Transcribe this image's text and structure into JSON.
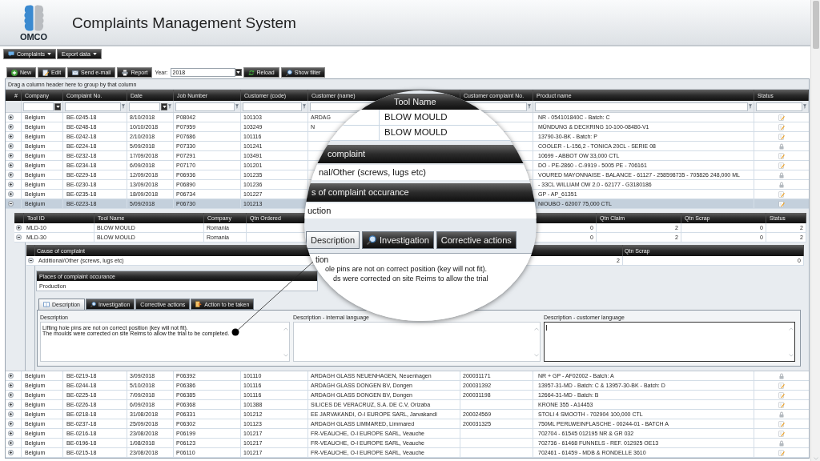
{
  "header": {
    "logo_text": "OMCO",
    "title": "Complaints Management System"
  },
  "menu": [
    {
      "label": "Complaints"
    },
    {
      "label": "Export data"
    }
  ],
  "toolbar": {
    "buttons": [
      "New",
      "Edit",
      "Send e-mail",
      "Report"
    ],
    "year": {
      "label": "Year:",
      "value": "2018"
    },
    "buttons_right": [
      "Reload",
      "Show filter"
    ]
  },
  "grid": {
    "group_hint": "Drag a column header here to group by that column",
    "columns": [
      "#",
      "Company",
      "Complaint No.",
      "Date",
      "Job Number",
      "Customer (code)",
      "Customer (name)",
      "Customer complaint No.",
      "Product name",
      "Status"
    ],
    "rows_top": [
      {
        "company": "Belgium",
        "complaint_no": "BE-0245-18",
        "date": "8/10/2018",
        "job_number": "P08042",
        "customer_code": "101103",
        "customer_name": "ARDAG",
        "product_name": "NR - 054101840C - Batch: C",
        "locked": false,
        "expanded": false,
        "selected": false
      },
      {
        "company": "Belgium",
        "complaint_no": "BE-0248-18",
        "date": "10/10/2018",
        "job_number": "P07959",
        "customer_code": "103249",
        "customer_name": "N",
        "product_name": "MÜNDUNG & DECKRING 10-100-08480-V1",
        "locked": false,
        "expanded": false,
        "selected": false
      },
      {
        "company": "Belgium",
        "complaint_no": "BE-0242-18",
        "date": "2/10/2018",
        "job_number": "P07686",
        "customer_code": "101116",
        "product_name": "13790-30-BK - Batch: P",
        "locked": false,
        "expanded": false,
        "selected": false
      },
      {
        "company": "Belgium",
        "complaint_no": "BE-0224-18",
        "date": "5/09/2018",
        "job_number": "P07330",
        "customer_code": "101241",
        "product_name": "COOLER - L-156,2 - TONICA 20CL - SERIE 08",
        "locked": true,
        "expanded": false,
        "selected": false
      },
      {
        "company": "Belgium",
        "complaint_no": "BE-0232-18",
        "date": "17/09/2018",
        "job_number": "P07291",
        "customer_code": "103491",
        "product_name": "10699 - ABBOT OW 33,000 CTL",
        "locked": false,
        "expanded": false,
        "selected": false
      },
      {
        "company": "Belgium",
        "complaint_no": "BE-0234-18",
        "date": "6/09/2018",
        "job_number": "P07170",
        "customer_code": "101201",
        "product_name": "DO - PE-2860 - C-9919 - 5005 PE - 706161",
        "locked": false,
        "expanded": false,
        "selected": false
      },
      {
        "company": "Belgium",
        "complaint_no": "BE-0229-18",
        "date": "12/09/2018",
        "job_number": "P06936",
        "customer_code": "101235",
        "product_name": "VOURED MAYONNAISE - BALANCE - 61127 - 258598735 - 705826 248,000 ML",
        "locked": true,
        "expanded": false,
        "selected": false
      },
      {
        "company": "Belgium",
        "complaint_no": "BE-0230-18",
        "date": "13/09/2018",
        "job_number": "P06890",
        "customer_code": "101236",
        "product_name": "- 33CL WILLIAM OW 2.0 - 62177 - G3180186",
        "locked": true,
        "expanded": false,
        "selected": false
      },
      {
        "company": "Belgium",
        "complaint_no": "BE-0235-18",
        "date": "18/09/2018",
        "job_number": "P06734",
        "customer_code": "101227",
        "product_name": "GP - AP_61351",
        "locked": false,
        "expanded": false,
        "selected": false
      },
      {
        "company": "Belgium",
        "complaint_no": "BE-0223-18",
        "date": "5/09/2018",
        "job_number": "P06730",
        "customer_code": "101213",
        "product_name": "NIOUBO - 62007 75,000 CTL",
        "locked": false,
        "expanded": true,
        "selected": true
      }
    ],
    "detail": {
      "tools": {
        "columns": [
          "Tool ID",
          "Tool Name",
          "Company",
          "Qtn Ordered",
          "Qtn Claim",
          "Qtn Scrap",
          "Status"
        ],
        "rows": [
          {
            "tool_id": "MLD-10",
            "tool_name": "BLOW MOULD",
            "company": "Romania",
            "column_5": "0",
            "qtn_claim": "2",
            "qtn_scrap": "0",
            "status": "2",
            "expanded": false
          },
          {
            "tool_id": "MLD-30",
            "tool_name": "BLOW MOULD",
            "company": "Romania",
            "column_5": "0",
            "qtn_claim": "2",
            "qtn_scrap": "0",
            "status": "2",
            "expanded": true
          }
        ]
      },
      "causes": {
        "columns": [
          "Cause of complaint",
          "Qtn Scrap"
        ],
        "rows": [
          {
            "cause": "Additional/Other (screws, lugs etc)",
            "column_3": "2",
            "qtn_scrap": "0",
            "expanded": true
          }
        ]
      },
      "places": {
        "column": "Places of complaint occurance",
        "rows": [
          "Production"
        ]
      },
      "tabs": [
        {
          "label": "Description",
          "selected": true
        },
        {
          "label": "Investigation",
          "selected": false
        },
        {
          "label": "Corrective actions",
          "selected": false
        },
        {
          "label": "Action to be taken",
          "selected": false
        }
      ],
      "fields": [
        {
          "label": "Description",
          "lines": [
            "Lifting hole pins are not on correct position (key will not fit).",
            "The moulds were corrected on site Reims to allow the trial to be completed."
          ],
          "focused": false
        },
        {
          "label": "Description - internal language",
          "focused": false
        },
        {
          "label": "Description - customer language",
          "focused": true
        }
      ]
    },
    "rows_bottom": [
      {
        "company": "Belgium",
        "complaint_no": "BE-0219-18",
        "date": "3/09/2018",
        "job_number": "P06392",
        "customer_code": "101110",
        "customer_name": "ARDAGH GLASS NEUENHAGEN, Neuenhagen",
        "customer_complaint_no": "200031171",
        "product_name": "NR + GP - AF02002 - Batch: A",
        "locked": true,
        "expanded": false,
        "selected": false
      },
      {
        "company": "Belgium",
        "complaint_no": "BE-0244-18",
        "date": "5/10/2018",
        "job_number": "P06386",
        "customer_code": "101116",
        "customer_name": "ARDAGH GLASS DONGEN BV, Dongen",
        "customer_complaint_no": "200031392",
        "product_name": "13957-31-MD - Batch: C & 13957-30-BK - Batch: D",
        "locked": false,
        "expanded": false,
        "selected": false
      },
      {
        "company": "Belgium",
        "complaint_no": "BE-0225-18",
        "date": "7/09/2018",
        "job_number": "P06385",
        "customer_code": "101116",
        "customer_name": "ARDAGH GLASS DONGEN BV, Dongen",
        "customer_complaint_no": "200031198",
        "product_name": "12664-31-MD - Batch: B",
        "locked": false,
        "expanded": false,
        "selected": false
      },
      {
        "company": "Belgium",
        "complaint_no": "BE-0226-18",
        "date": "6/09/2018",
        "job_number": "P06368",
        "customer_code": "101388",
        "customer_name": "SILICES DE VERACRUZ, S.A. DE C.V, Orizaba",
        "product_name": "KRONE 355 - A14453",
        "locked": false,
        "expanded": false,
        "selected": false
      },
      {
        "company": "Belgium",
        "complaint_no": "BE-0218-18",
        "date": "31/08/2018",
        "job_number": "P06331",
        "customer_code": "101212",
        "customer_name": "EE JARVAKANDI, O-I EUROPE SARL, Jarvakandi",
        "customer_complaint_no": "200024569",
        "product_name": "STOLI 4 SMOOTH - 702904 100,000 CTL",
        "locked": true,
        "expanded": false,
        "selected": false
      },
      {
        "company": "Belgium",
        "complaint_no": "BE-0237-18",
        "date": "25/09/2018",
        "job_number": "P06302",
        "customer_code": "101123",
        "customer_name": "ARDAGH GLASS LIMMARED, Limmared",
        "customer_complaint_no": "200031325",
        "product_name": "750ML PERLWEINFLASCHE - 00244-01 - BATCH A",
        "locked": false,
        "expanded": false,
        "selected": false
      },
      {
        "company": "Belgium",
        "complaint_no": "BE-0216-18",
        "date": "23/08/2018",
        "job_number": "P06199",
        "customer_code": "101217",
        "customer_name": "FR-VEAUCHE, O-I EUROPE SARL, Veauche",
        "product_name": "702704 - 61545 012195 NR & GR 032",
        "locked": false,
        "expanded": false,
        "selected": false
      },
      {
        "company": "Belgium",
        "complaint_no": "BE-0196-18",
        "date": "1/08/2018",
        "job_number": "P06123",
        "customer_code": "101217",
        "customer_name": "FR-VEAUCHE, O-I EUROPE SARL, Veauche",
        "product_name": "702736 - 61468 FUNNELS - REF. 012925 OE13",
        "locked": true,
        "expanded": false,
        "selected": false
      },
      {
        "company": "Belgium",
        "complaint_no": "BE-0215-18",
        "date": "23/08/2018",
        "job_number": "P06110",
        "customer_code": "101217",
        "customer_name": "FR-VEAUCHE, O-I EUROPE SARL, Veauche",
        "product_name": "702461 - 61459 - MDB & RONDELLE 3610",
        "locked": false,
        "expanded": false,
        "selected": false
      }
    ]
  },
  "magnifier": {
    "tool_header": "Tool Name",
    "tool_rows": [
      "BLOW MOULD",
      "BLOW MOULD"
    ],
    "cause_header": "complaint",
    "cause_row": "nal/Other (screws, lugs etc)",
    "places_header": "s of complaint occurance",
    "places_row": "uction",
    "tabs": [
      {
        "label": "Description",
        "selected": true
      },
      {
        "label": "Investigation",
        "selected": false
      },
      {
        "label": "Corrective actions",
        "selected": false
      }
    ],
    "field_label": "tion",
    "lines": [
      "ole pins are not on correct position (key will not fit).",
      "ds were corrected on site Reims to allow the trial"
    ]
  }
}
